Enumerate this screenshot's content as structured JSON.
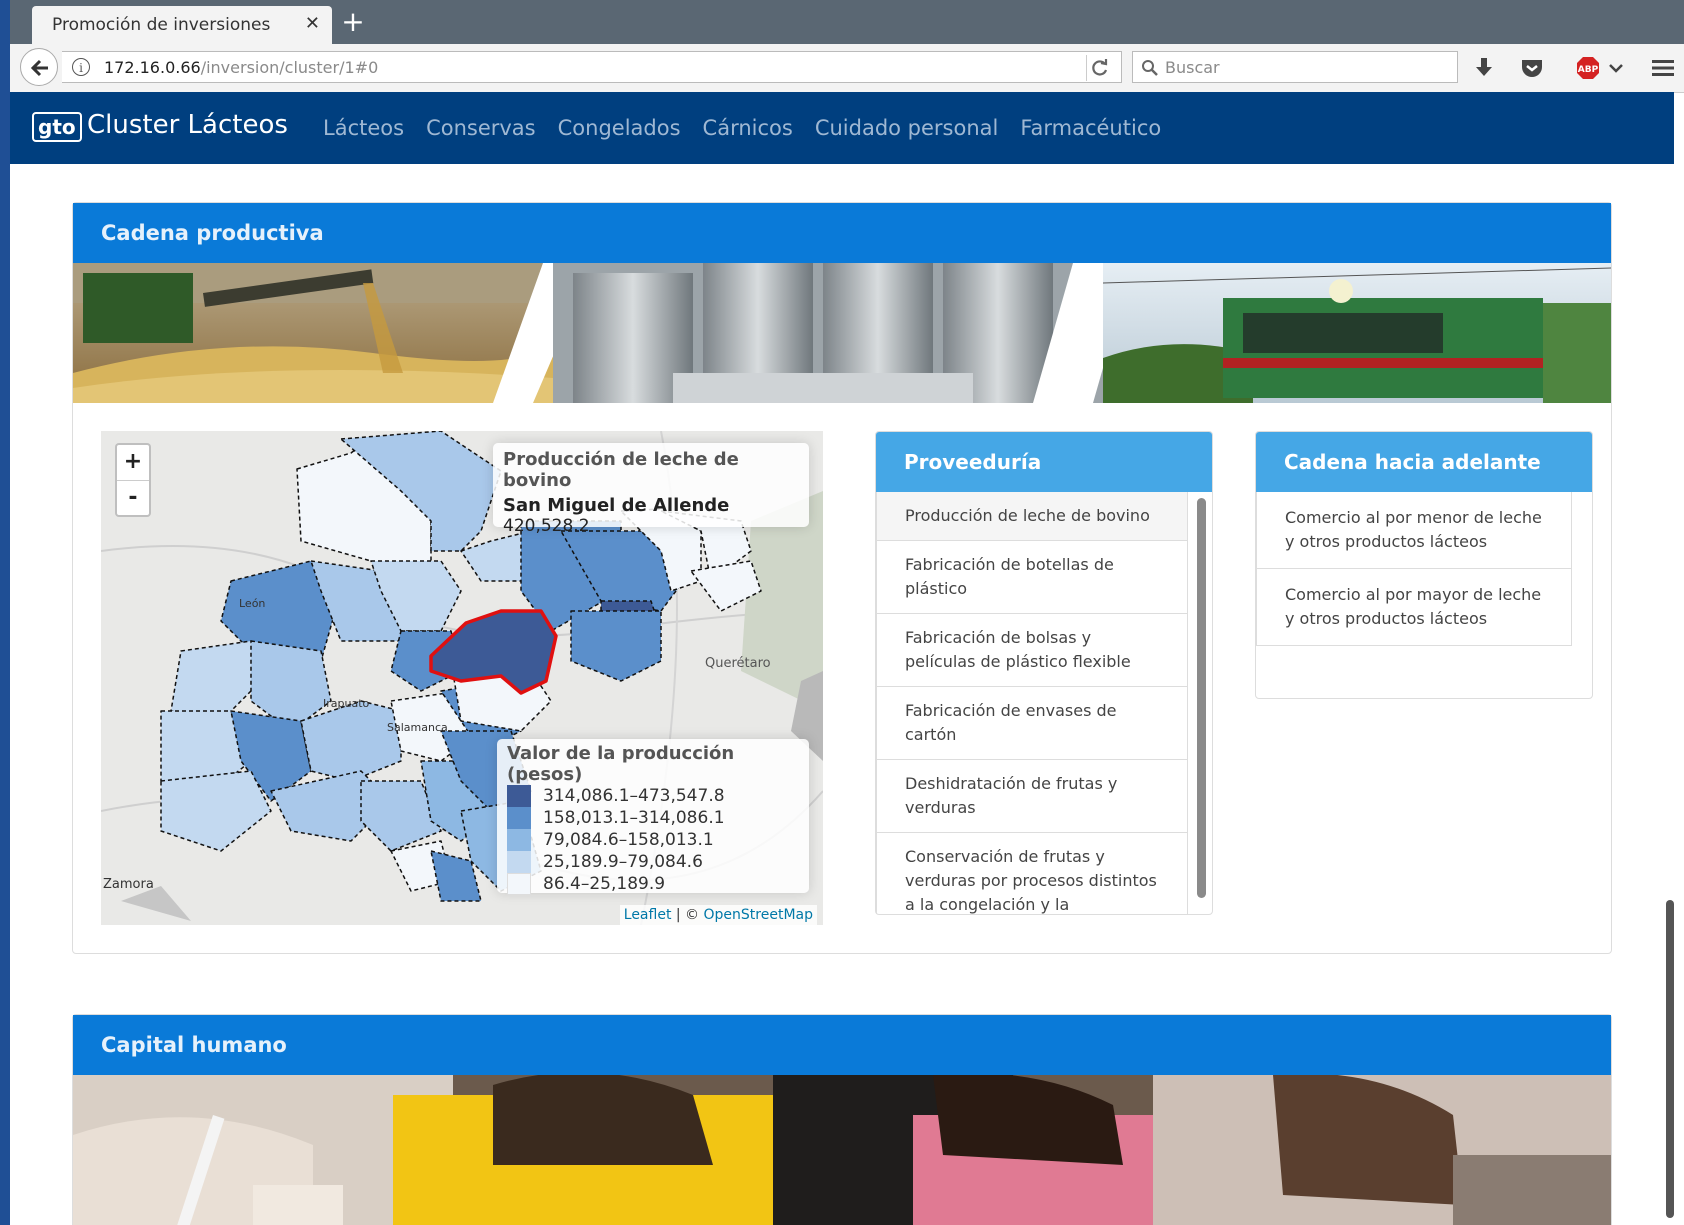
{
  "browser": {
    "tab_title": "Promoción de inversiones",
    "url_host": "172.16.0.66",
    "url_path": "/inversion/cluster/1#0",
    "search_placeholder": "Buscar",
    "adblock_label": "ABP"
  },
  "app": {
    "brand_logo": "gto",
    "brand_name": "Cluster Lácteos",
    "menu": [
      "Lácteos",
      "Conservas",
      "Congelados",
      "Cárnicos",
      "Cuidado personal",
      "Farmacéutico"
    ]
  },
  "cadena": {
    "title": "Cadena productiva",
    "map": {
      "zoom_in": "+",
      "zoom_out": "-",
      "info_title": "Producción de leche de bovino",
      "info_name": "San Miguel de Allende",
      "info_value": "420,528.2",
      "legend_title": "Valor de la producción (pesos)",
      "legend": [
        {
          "label": "314,086.1–473,547.8",
          "color": "#3d5a96"
        },
        {
          "label": "158,013.1–314,086.1",
          "color": "#5b8fcb"
        },
        {
          "label": "79,084.6–158,013.1",
          "color": "#8db8e3"
        },
        {
          "label": "25,189.9–79,084.6",
          "color": "#c3d9f0"
        },
        {
          "label": "86.4–25,189.9",
          "color": "#f3f7fb"
        }
      ],
      "place_labels": [
        "León",
        "Irapuato",
        "Salamanca",
        "Querétaro",
        "Zamora"
      ],
      "attrib_leaflet": "Leaflet",
      "attrib_sep": "| ©",
      "attrib_osm": "OpenStreetMap"
    },
    "proveeduria": {
      "title": "Proveeduría",
      "items": [
        "Producción de leche de bovino",
        "Fabricación de botellas de plástico",
        "Fabricación de bolsas y películas de plástico flexible",
        "Fabricación de envases de cartón",
        "Deshidratación de frutas y verduras",
        "Conservación de frutas y verduras por procesos distintos a la congelación y la deshidratación"
      ]
    },
    "adelante": {
      "title": "Cadena hacia adelante",
      "items": [
        "Comercio al por menor de leche y otros productos lácteos",
        "Comercio al por mayor de leche y otros productos lácteos"
      ]
    }
  },
  "capital": {
    "title": "Capital humano"
  }
}
